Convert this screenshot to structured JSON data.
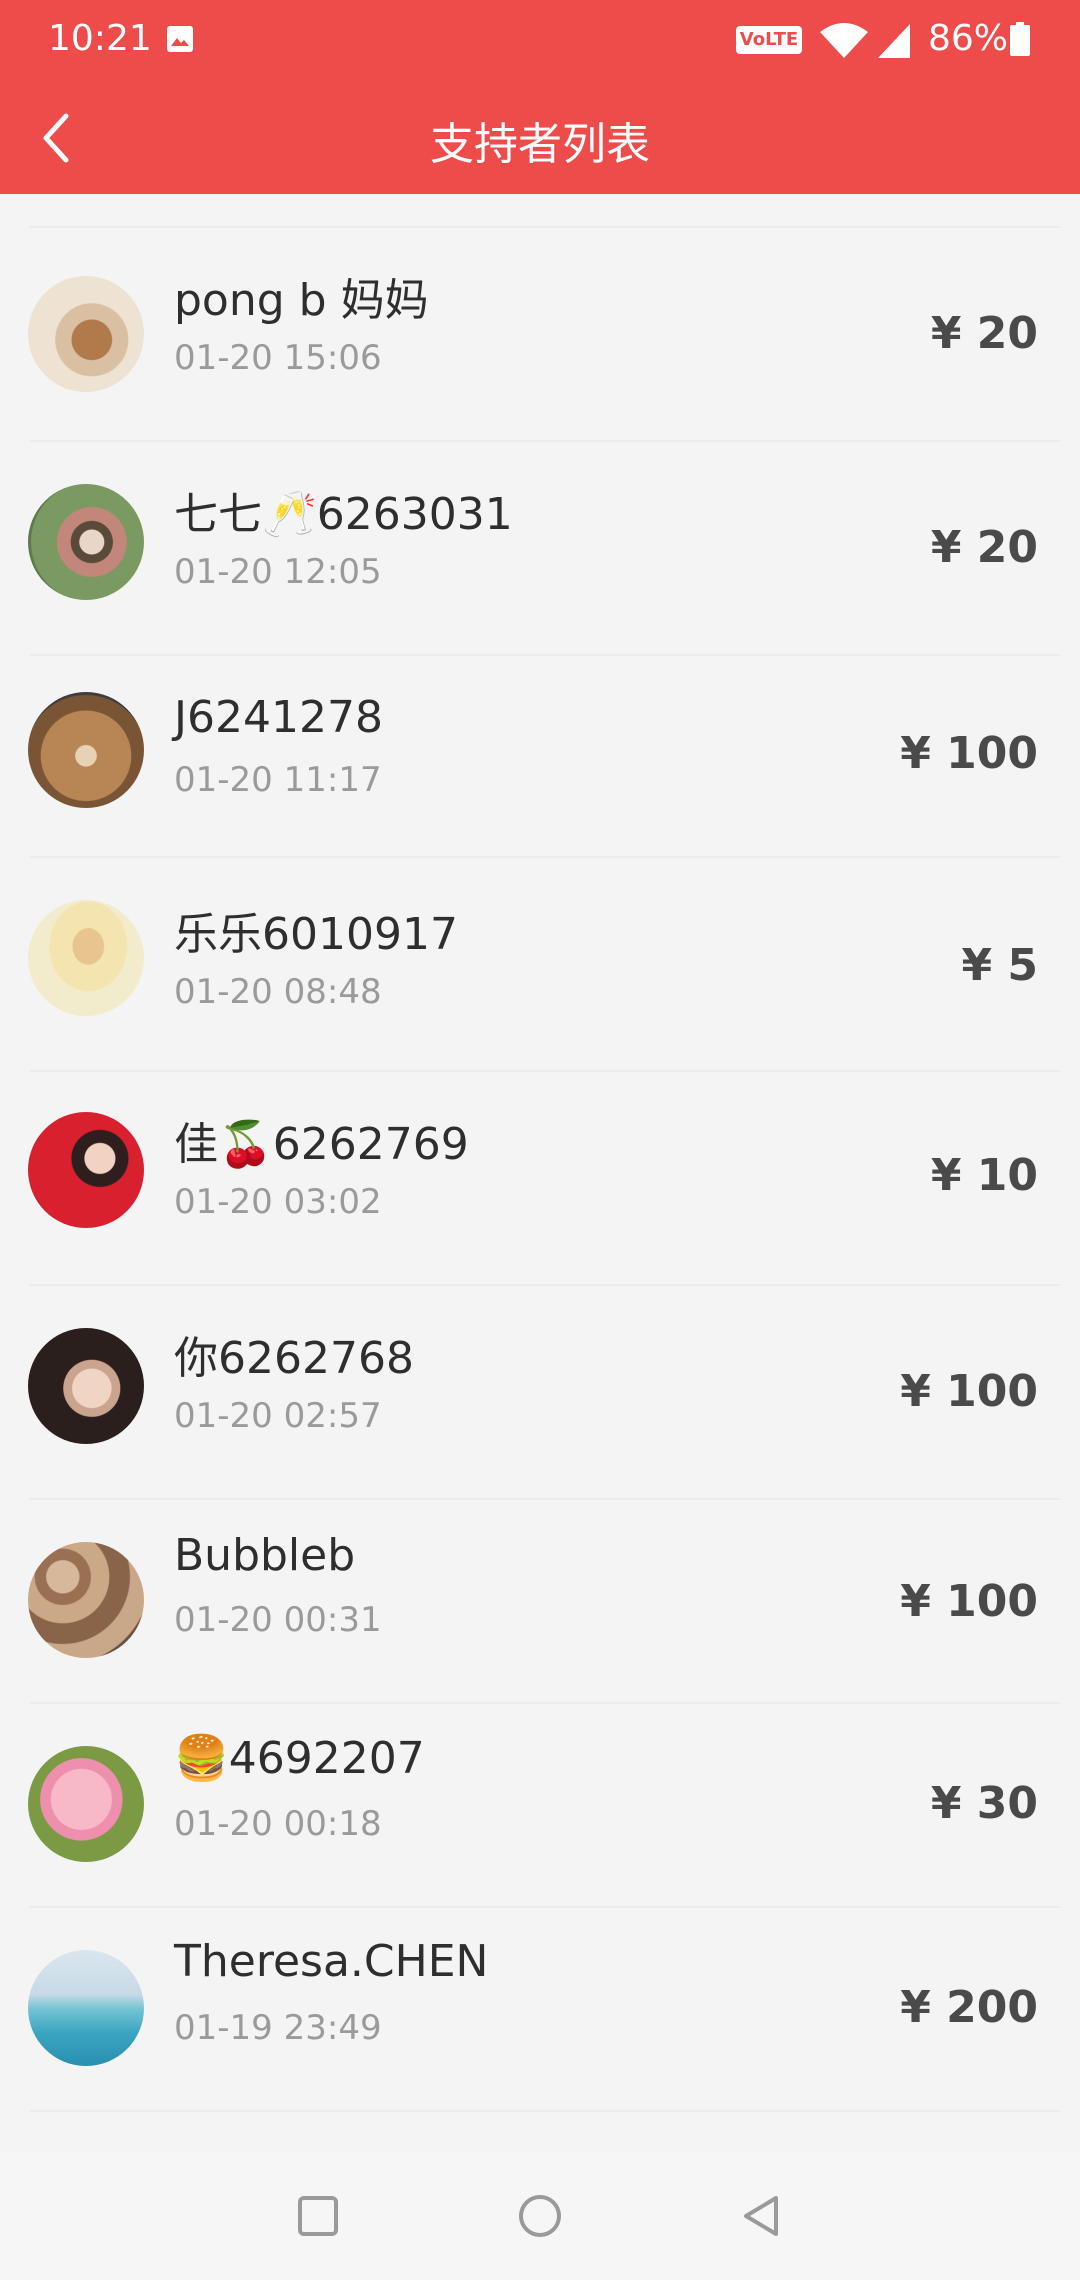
{
  "status_bar": {
    "time": "10:21",
    "volte": "VoLTE",
    "battery": "86%",
    "gallery_icon": "image-icon",
    "wifi_icon": "wifi-icon",
    "signal_icon": "signal-icon",
    "battery_icon": "battery-icon"
  },
  "header": {
    "title": "支持者列表",
    "back_icon": "chevron-left-icon",
    "background": "#ee4b4b"
  },
  "supporters": [
    {
      "name": "pong b 妈妈",
      "time": "01-20 15:06",
      "amount": "¥ 20",
      "avatar": "bear-figure-avatar"
    },
    {
      "name": "七七🥂6263031",
      "time": "01-20 12:05",
      "amount": "¥ 20",
      "avatar": "girl-flowers-avatar"
    },
    {
      "name": "J6241278",
      "time": "01-20 11:17",
      "amount": "¥ 100",
      "avatar": "teddy-bear-avatar"
    },
    {
      "name": "乐乐6010917",
      "time": "01-20 08:48",
      "amount": "¥ 5",
      "avatar": "flower-avatar"
    },
    {
      "name": "佳🍒6262769",
      "time": "01-20 03:02",
      "amount": "¥ 10",
      "avatar": "red-dress-avatar"
    },
    {
      "name": "你6262768",
      "time": "01-20 02:57",
      "amount": "¥ 100",
      "avatar": "portrait-avatar"
    },
    {
      "name": "Bubbleb",
      "time": "01-20 00:31",
      "amount": "¥ 100",
      "avatar": "animals-avatar"
    },
    {
      "name": "🍔4692207",
      "time": "01-20 00:18",
      "amount": "¥ 30",
      "avatar": "pink-pig-avatar"
    },
    {
      "name": "Theresa.CHEN",
      "time": "01-19 23:49",
      "amount": "¥ 200",
      "avatar": "sea-avatar"
    }
  ],
  "nav_bar": {
    "recents_icon": "square-icon",
    "home_icon": "circle-icon",
    "back_icon": "triangle-back-icon"
  }
}
